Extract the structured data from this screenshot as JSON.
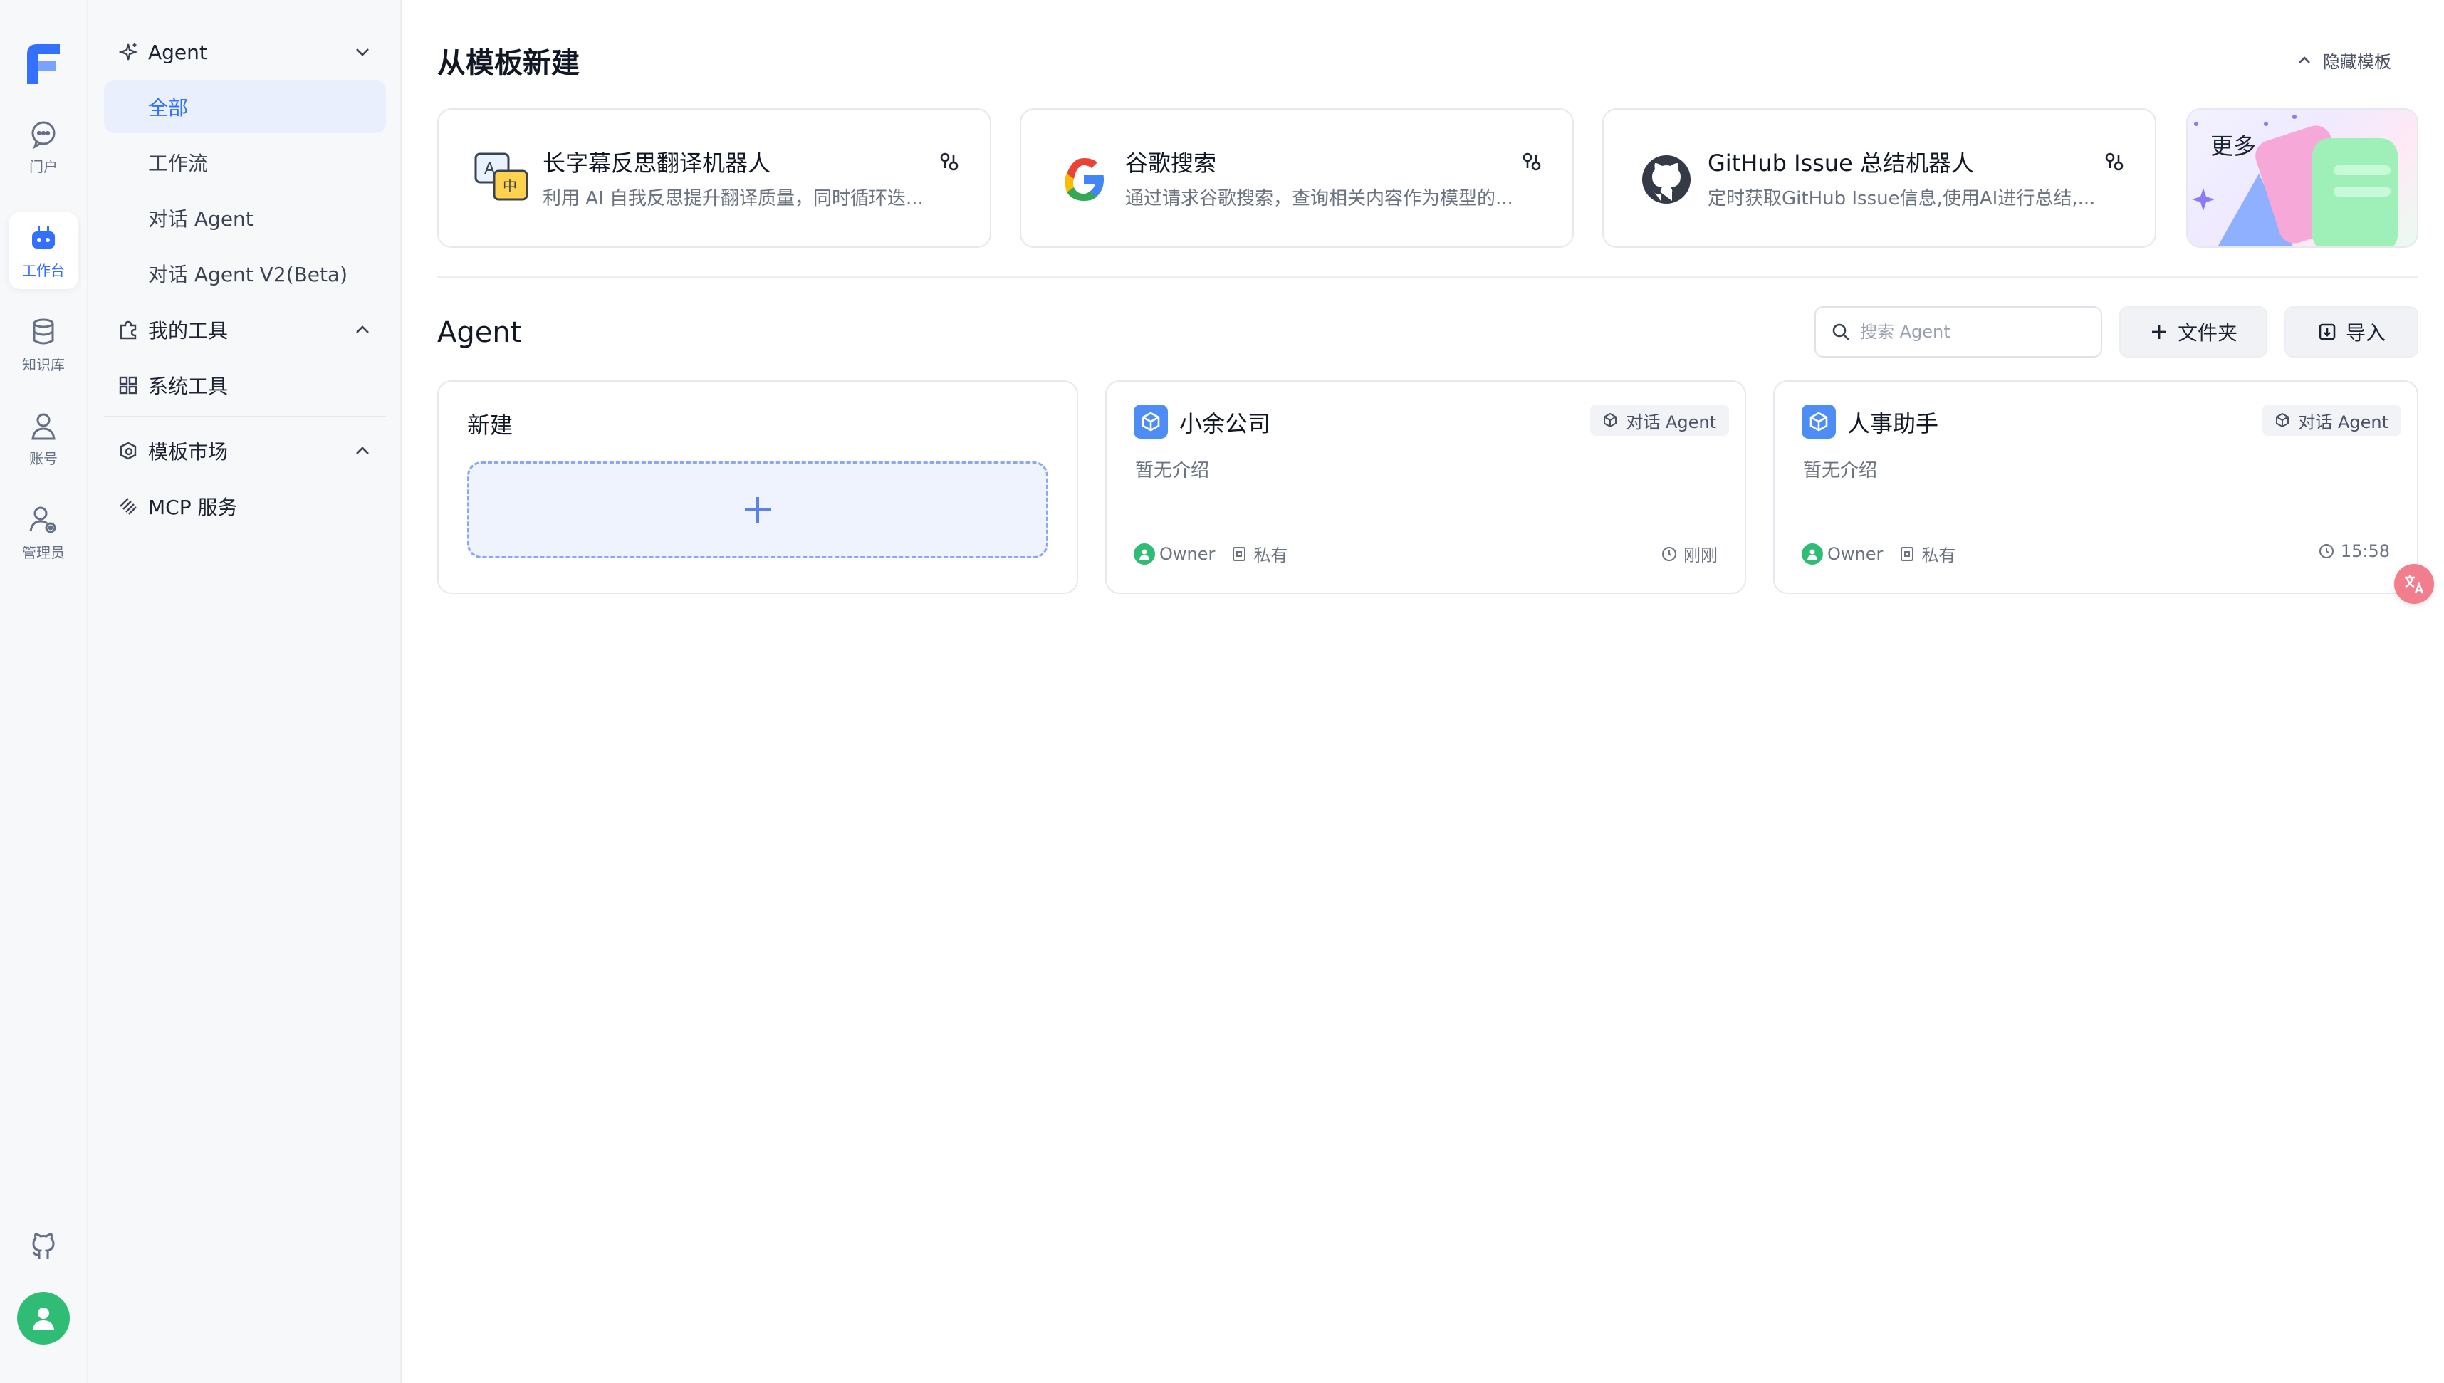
{
  "rail": {
    "items": [
      {
        "label": "门户",
        "icon": "chat-bubble-icon"
      },
      {
        "label": "工作台",
        "icon": "robot-icon"
      },
      {
        "label": "知识库",
        "icon": "database-icon"
      },
      {
        "label": "账号",
        "icon": "user-icon"
      },
      {
        "label": "管理员",
        "icon": "user-gear-icon"
      }
    ],
    "active_index": 1
  },
  "sidebar": {
    "agent_group": "Agent",
    "agent_subs": [
      "全部",
      "工作流",
      "对话 Agent",
      "对话 Agent V2(Beta)"
    ],
    "tools_group": "我的工具",
    "system_tools": "系统工具",
    "market_group": "模板市场",
    "mcp": "MCP 服务"
  },
  "templates": {
    "title": "从模板新建",
    "hide_label": "隐藏模板",
    "cards": [
      {
        "name": "长字幕反思翻译机器人",
        "desc": "利用 AI 自我反思提升翻译质量，同时循环迭..."
      },
      {
        "name": "谷歌搜索",
        "desc": "通过请求谷歌搜索，查询相关内容作为模型的..."
      },
      {
        "name": "GitHub Issue 总结机器人",
        "desc": "定时获取GitHub Issue信息,使用AI进行总结,..."
      }
    ],
    "more_label": "更多"
  },
  "agents": {
    "title": "Agent",
    "search_placeholder": "搜索 Agent",
    "folder_label": "文件夹",
    "import_label": "导入",
    "new_label": "新建",
    "cards": [
      {
        "name": "小余公司",
        "badge": "对话 Agent",
        "intro": "暂无介绍",
        "owner": "Owner",
        "visibility": "私有",
        "time": "刚刚"
      },
      {
        "name": "人事助手",
        "badge": "对话 Agent",
        "intro": "暂无介绍",
        "owner": "Owner",
        "visibility": "私有",
        "time": "15:58"
      }
    ]
  },
  "colors": {
    "accent": "#3370ff",
    "active_bg": "#e9effd",
    "avatar": "#2fbd75"
  }
}
